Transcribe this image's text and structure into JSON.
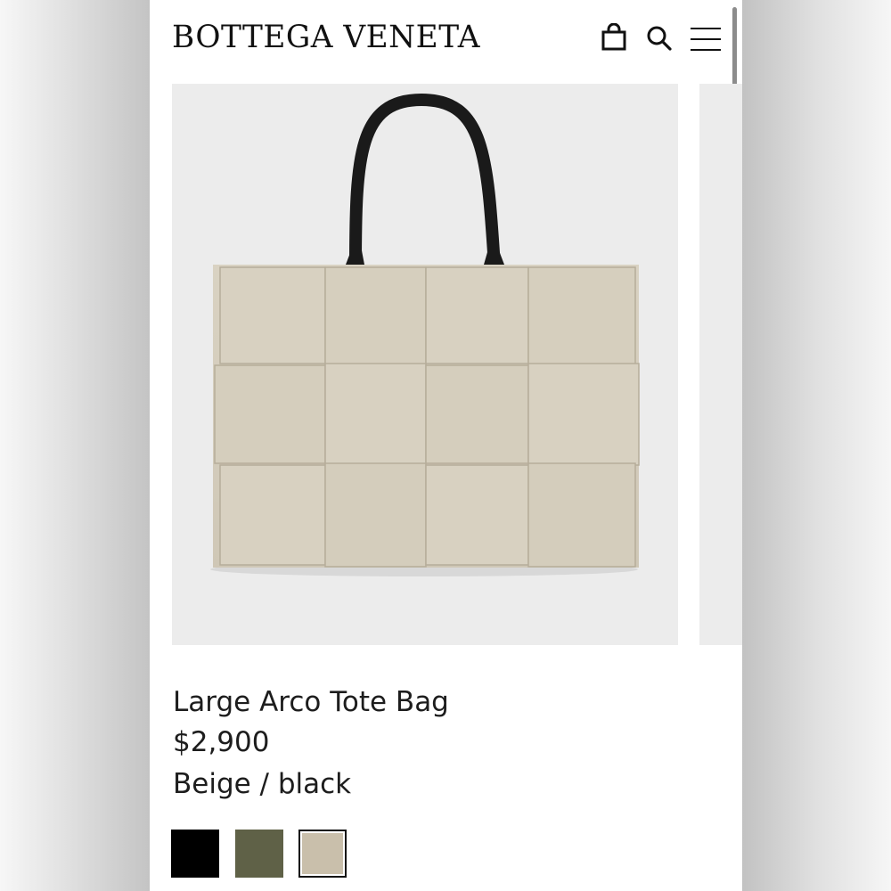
{
  "header": {
    "brand": "BOTTEGA VENETA",
    "icons": [
      "shopping-bag-icon",
      "search-icon",
      "menu-icon"
    ]
  },
  "gallery": {
    "image": "bag-image",
    "has_next_image": true
  },
  "product": {
    "title": "Large Arco Tote Bag",
    "price": "$2,900",
    "color": "Beige / black"
  },
  "swatches": [
    {
      "name": "black",
      "hex": "#000000"
    },
    {
      "name": "olive",
      "hex": "#5f6147"
    },
    {
      "name": "beige",
      "hex": "#c9bfab",
      "selected": true
    }
  ]
}
